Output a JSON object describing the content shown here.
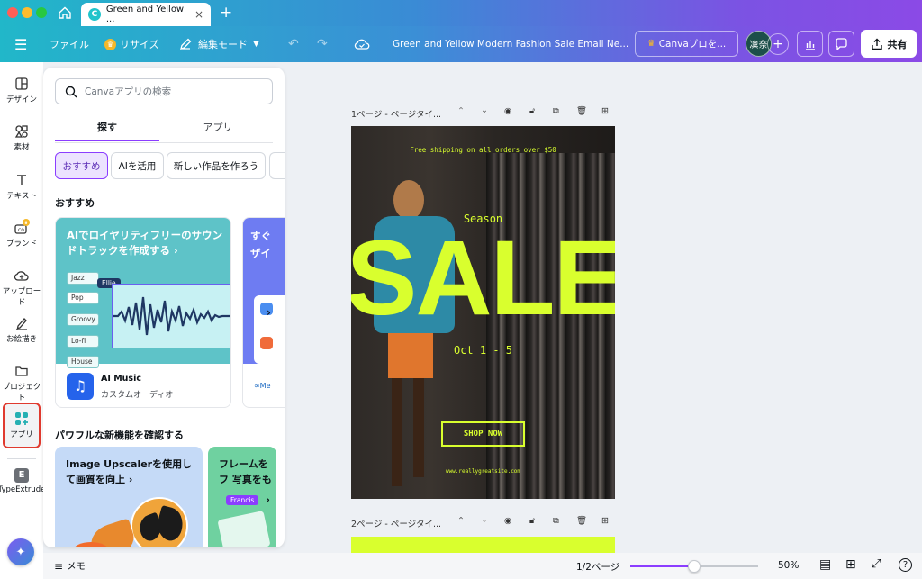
{
  "browser": {
    "tab_title": "Green and Yellow ...",
    "tab_favicon": "C"
  },
  "toolbar": {
    "file": "ファイル",
    "resize": "リサイズ",
    "edit_mode": "編集モード",
    "doc_title": "Green and Yellow Modern Fashion Sale Email Ne...",
    "pro_button": "Canvaプロを...",
    "avatar": "凜奈",
    "share": "共有"
  },
  "sidebar": {
    "items": [
      {
        "label": "デザイン",
        "icon": "design-icon"
      },
      {
        "label": "素材",
        "icon": "elements-icon"
      },
      {
        "label": "テキスト",
        "icon": "text-icon"
      },
      {
        "label": "ブランド",
        "icon": "brand-icon"
      },
      {
        "label": "アップロード",
        "icon": "upload-icon"
      },
      {
        "label": "お絵描き",
        "icon": "draw-icon"
      },
      {
        "label": "プロジェクト",
        "icon": "folder-icon"
      },
      {
        "label": "アプリ",
        "icon": "apps-icon"
      },
      {
        "label": "TypeExtrude",
        "icon": "typeextrude-icon"
      }
    ]
  },
  "panel": {
    "search_placeholder": "Canvaアプリの検索",
    "tabs": [
      "探す",
      "アプリ"
    ],
    "chips": [
      "おすすめ",
      "AIを活用",
      "新しい作品を作ろう"
    ],
    "section1": "おすすめ",
    "card1": {
      "headline": "AIでロイヤリティフリーのサウンドトラックを作成する ›",
      "tags": [
        "Jazz",
        "Pop",
        "Groovy",
        "Lo-fi",
        "House"
      ],
      "tooltip": "Ellie",
      "app_name": "AI Music",
      "app_desc": "カスタムオーディオ"
    },
    "card2": {
      "headline_partial": "すぐ ザイ",
      "brand_partial": "∞Me"
    },
    "section2": "パワフルな新機能を確認する",
    "card3": {
      "headline": "Image Upscalerを使用して画質を向上 ›"
    },
    "card4": {
      "headline": "フレームを フ 写真をもっと",
      "tooltip": "Francis"
    }
  },
  "canvas": {
    "page1_label": "1ページ - ページタイ...",
    "page2_label": "2ページ - ページタイ...",
    "design": {
      "shipping": "Free shipping on all orders over $50",
      "season": "Season",
      "sale": "SALE",
      "dates": "Oct 1 - 5",
      "shop_now": "SHOP NOW",
      "website": "www.reallygreatsite.com"
    }
  },
  "bottombar": {
    "notes": "メモ",
    "page_count": "1/2ページ",
    "zoom": "50%",
    "zoom_level": 0.5
  },
  "colors": {
    "accent_purple": "#8b3dff",
    "sale_yellow": "#d9ff2e",
    "highlight_red": "#e03a2f"
  }
}
